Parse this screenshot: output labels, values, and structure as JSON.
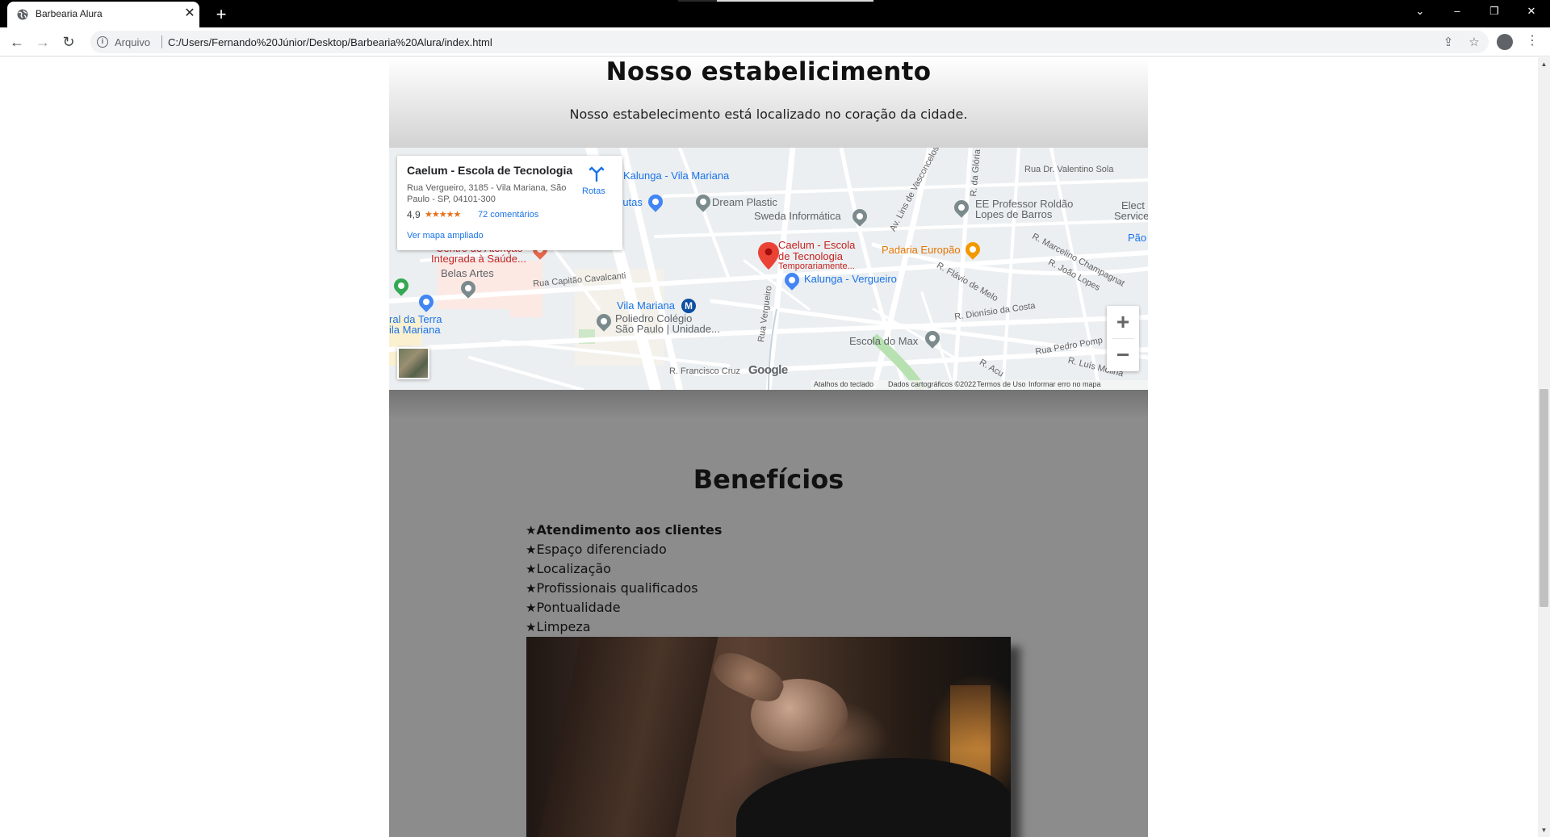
{
  "browser": {
    "tab_title": "Barbearia Alura",
    "tab_close": "✕",
    "new_tab": "+",
    "url_scheme": "Arquivo",
    "url": "C:/Users/Fernando%20Júnior/Desktop/Barbearia%20Alura/index.html",
    "icons": {
      "back": "←",
      "forward": "→",
      "reload": "↻",
      "share": "⇪",
      "bookmark": "☆",
      "menu": "⋮",
      "tab_list": "⌄",
      "minimize": "–",
      "restore": "❐",
      "close": "✕"
    }
  },
  "establishment": {
    "title": "Nosso estabelicimento",
    "description": "Nosso estabelecimento está localizado no coração da cidade."
  },
  "map": {
    "place_name": "Caelum - Escola de Tecnologia",
    "address": "Rua Vergueiro, 3185 - Vila Mariana, São Paulo - SP, 04101-300",
    "rating": "4,9",
    "stars": "★★★★★",
    "reviews": "72 comentários",
    "view_larger": "Ver mapa ampliado",
    "directions": "Rotas",
    "marker_title_1": "Caelum - Escola",
    "marker_title_2": "de Tecnologia",
    "marker_subtitle": "Temporariamente...",
    "labels": {
      "kalunga_vm": "Kalunga - Vila Mariana",
      "frutas": "rutas",
      "dream_plastic": "Dream Plastic",
      "sweda": "Sweda Informática",
      "ee_professor_1": "EE Professor Roldão",
      "ee_professor_2": "Lopes de Barros",
      "valentino": "Rua Dr. Valentino Sola",
      "elect_1": "Elect",
      "elect_2": "Service",
      "pao": "Pão",
      "centro_1": "Centro de Atenção",
      "centro_2": "Integrada à Saúde...",
      "padaria": "Padaria Europão",
      "belas_artes": "Belas Artes",
      "capitao": "Rua Capitão Cavalcanti",
      "kalunga_verg": "Kalunga - Vergueiro",
      "vila_mariana": "Vila Mariana",
      "poliedro_1": "Poliedro Colégio",
      "poliedro_2": "São Paulo | Unidade...",
      "terra_1": "ral da Terra",
      "terra_2": "ila Mariana",
      "escola_max": "Escola do Max",
      "francisco": "R. Francisco Cruz",
      "vergueiro": "Rua Vergueiro",
      "lins": "Av. Lins de Vasconcelos",
      "gloria": "R. da Glória",
      "marcelino": "R. Marcelino Champagnat",
      "joao_lopes": "R. João Lopes",
      "flavio": "R. Flávio de Melo",
      "dionisio": "R. Dionísio da Costa",
      "pedro_pomp": "Rua Pedro Pomp",
      "luis_molina": "R. Luís Molina",
      "acu": "R. Acu"
    },
    "google": "Google",
    "footer": {
      "shortcuts": "Atalhos do teclado",
      "data": "Dados cartográficos ©2022",
      "terms": "Termos de Uso",
      "report": "Informar erro no mapa"
    },
    "zoom_in": "+",
    "zoom_out": "−"
  },
  "benefits": {
    "title": "Benefícios",
    "star": "★",
    "items": [
      "Atendimento aos clientes",
      "Espaço diferenciado",
      "Localização",
      "Profissionais qualificados",
      "Pontualidade",
      "Limpeza"
    ]
  }
}
